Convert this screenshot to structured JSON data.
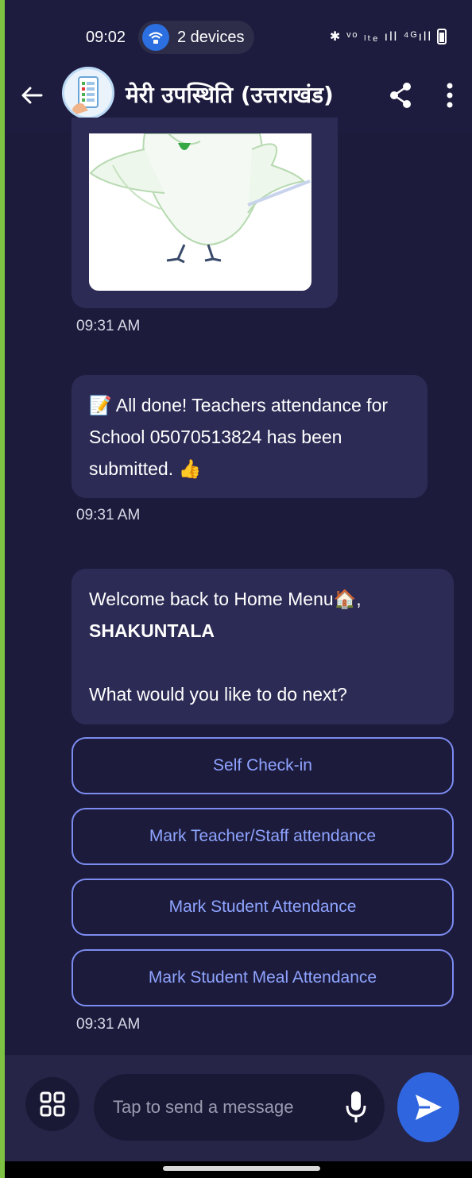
{
  "status_bar": {
    "time": "09:02",
    "devices_label": "2 devices",
    "network_text": "ᵛᵒ ₗₜₑ ıll ⁴ᴳıll"
  },
  "header": {
    "title": "मेरी उपस्थिति (उत्तराखंड)",
    "icons": [
      "back-arrow-icon",
      "share-icon",
      "more-vertical-icon"
    ]
  },
  "messages": [
    {
      "type": "image",
      "timestamp": "09:31 AM"
    },
    {
      "type": "text",
      "emoji_start": "📝",
      "text": "All done! Teachers attendance for School 05070513824 has been submitted.",
      "emoji_end": "👍",
      "timestamp": "09:31 AM"
    },
    {
      "type": "menu",
      "line1": "Welcome back to Home Menu🏠,",
      "line2": "SHAKUNTALA",
      "line3": "What would you like to do next?",
      "buttons": [
        "Self Check-in",
        "Mark Teacher/Staff attendance",
        "Mark Student Attendance",
        "Mark Student Meal Attendance"
      ],
      "timestamp": "09:31 AM"
    }
  ],
  "input_bar": {
    "placeholder": "Tap to send a message"
  },
  "colors": {
    "background": "#1c1b3c",
    "bubble": "#2c2b55",
    "accent": "#2f66e0",
    "button_border": "#7c8cf0",
    "button_text": "#8fa4ff",
    "frame": "#7dc242"
  }
}
